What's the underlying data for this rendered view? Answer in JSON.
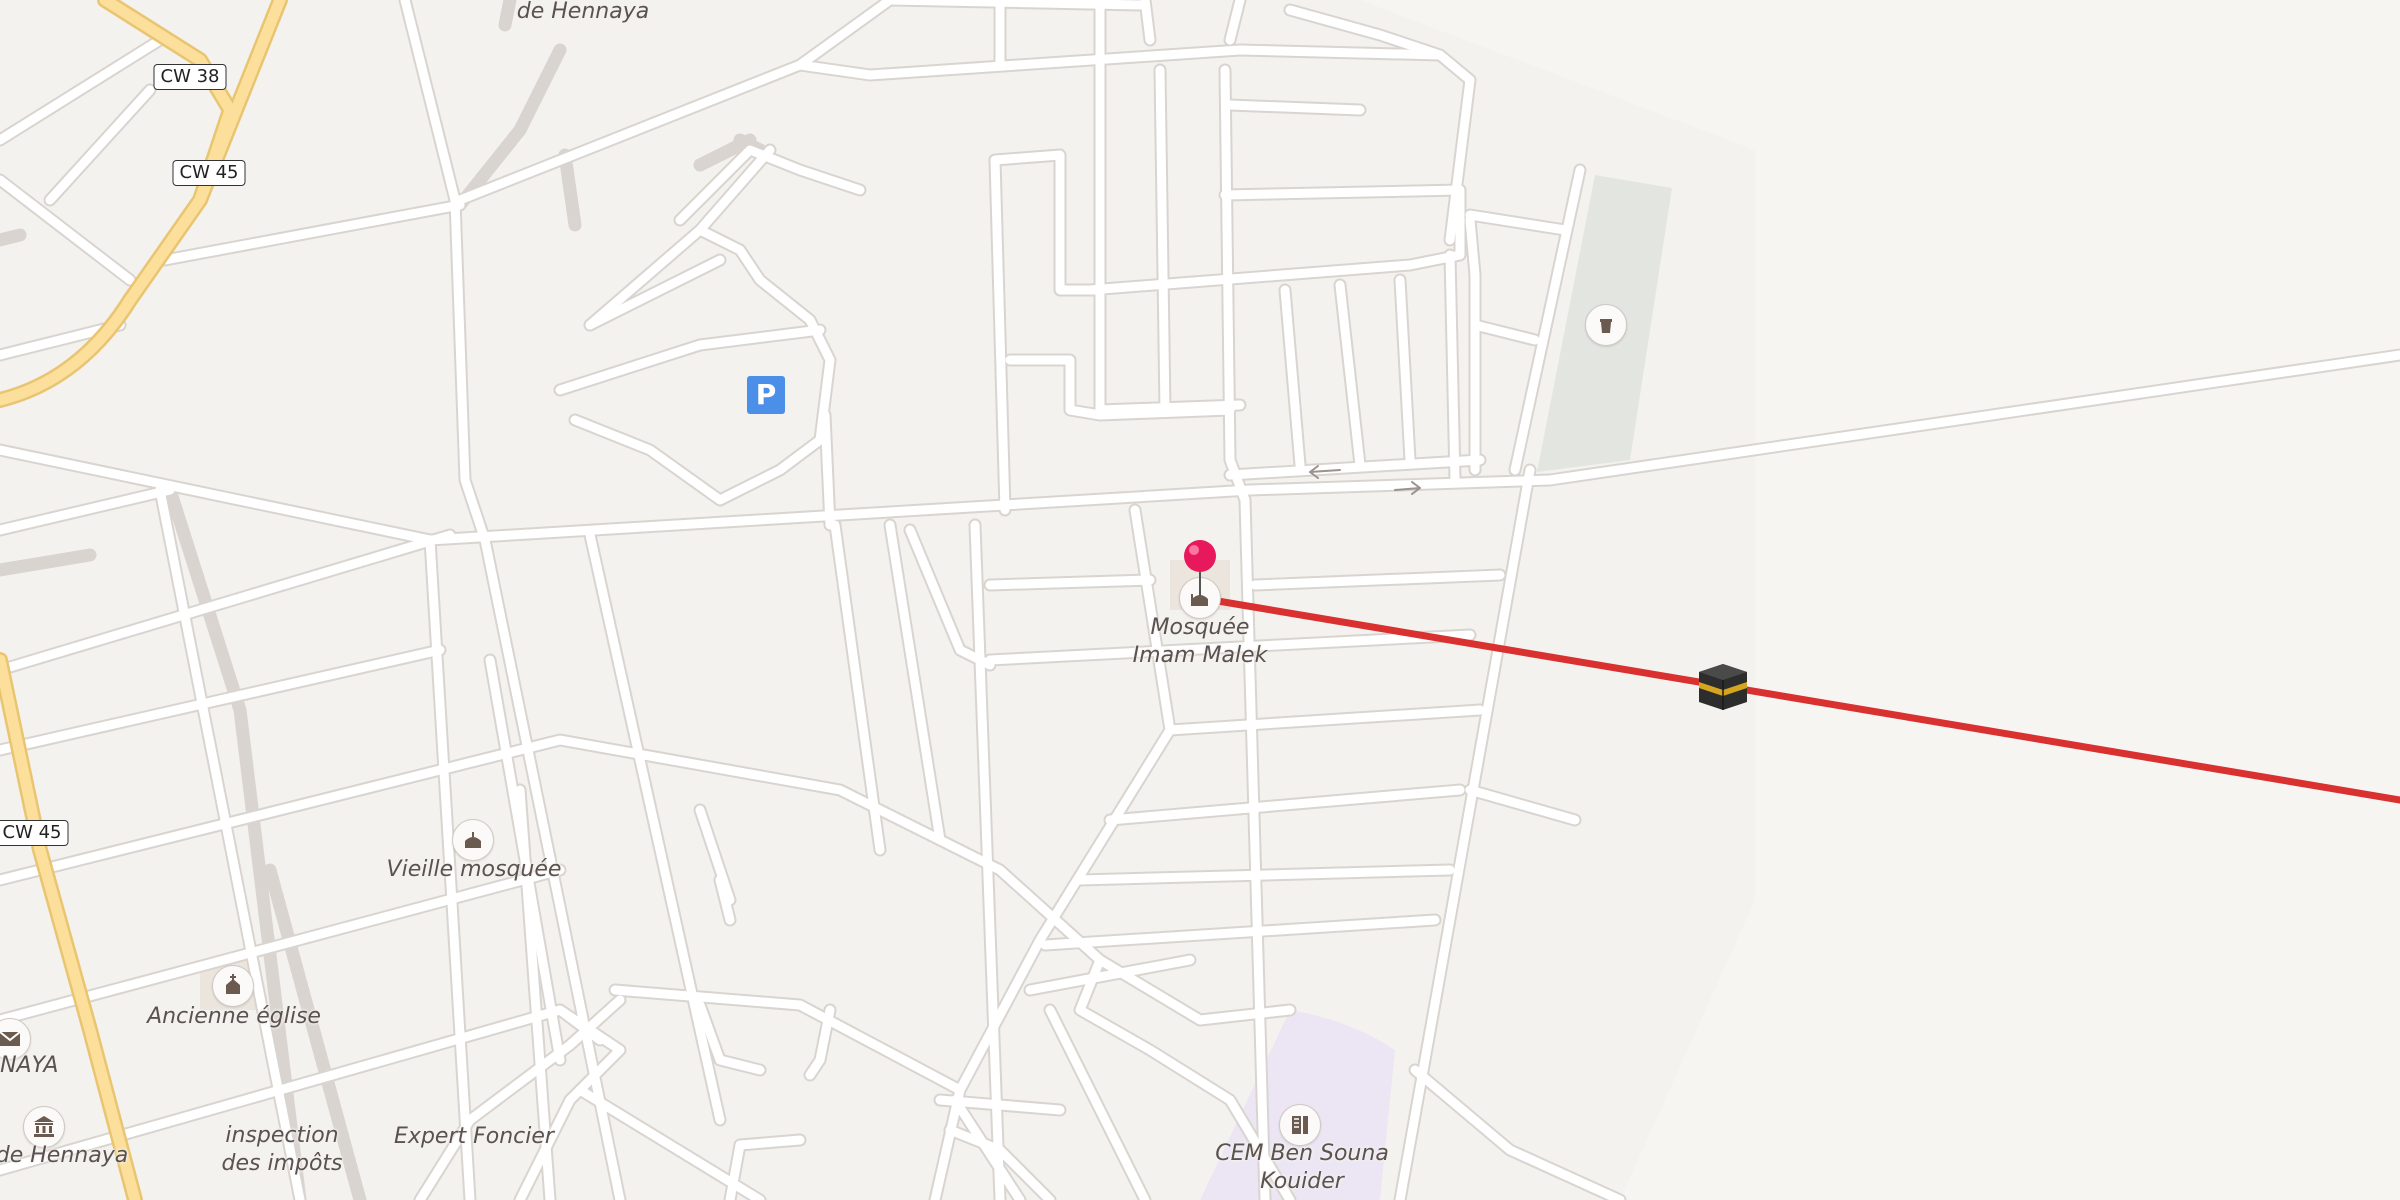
{
  "map": {
    "labels": {
      "hennaya_top": "de Hennaya",
      "mosquee_imam_malek_1": "Mosquée",
      "mosquee_imam_malek_2": "Imam Malek",
      "vieille_mosquee": "Vieille mosquée",
      "ancienne_eglise": "Ancienne église",
      "inaya": "INAYA",
      "hennaya_bottom": "de Hennaya",
      "inspection_1": "inspection",
      "inspection_2": "des impôts",
      "expert_foncier": "Expert Foncier",
      "cem_1": "CEM Ben Souna",
      "cem_2": "Kouider"
    },
    "road_shields": {
      "cw38": "CW 38",
      "cw45_top": "CW 45",
      "cw45_left": "CW 45"
    },
    "parking_label": "P",
    "icons": {
      "mosque": "mosque-icon",
      "church": "church-icon",
      "mail": "mail-icon",
      "bank": "bank-icon",
      "school": "school-icon",
      "cemetery": "cemetery-icon",
      "parking": "parking-icon",
      "pin": "location-pin-icon",
      "kaaba": "kaaba-icon"
    },
    "colors": {
      "background": "#f4f2ef",
      "road": "#ffffff",
      "road_casing": "#d9d4cf",
      "highway": "#fbdf9a",
      "highway_casing": "#e9c572",
      "qibla_line": "#d93030",
      "pin": "#e8185d",
      "school_area": "#ece6f4",
      "cemetery_area": "#e2e5e0",
      "parking": "#4b8fe8"
    }
  }
}
